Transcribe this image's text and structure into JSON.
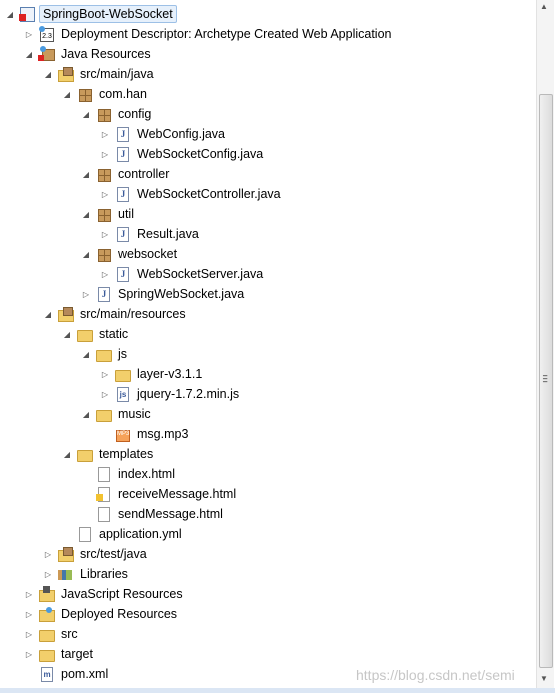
{
  "tree": [
    {
      "label": "SpringBoot-WebSocket",
      "level": 0,
      "state": "open",
      "icon": "project-icon",
      "selected": true
    },
    {
      "label": "Deployment Descriptor: Archetype Created Web Application",
      "level": 1,
      "state": "closed",
      "icon": "deployment-descriptor-icon"
    },
    {
      "label": "Java Resources",
      "level": 1,
      "state": "open",
      "icon": "java-resources-icon"
    },
    {
      "label": "src/main/java",
      "level": 2,
      "state": "open",
      "icon": "source-folder-icon"
    },
    {
      "label": "com.han",
      "level": 3,
      "state": "open",
      "icon": "package-icon"
    },
    {
      "label": "config",
      "level": 4,
      "state": "open",
      "icon": "package-icon"
    },
    {
      "label": "WebConfig.java",
      "level": 5,
      "state": "closed",
      "icon": "java-file-icon"
    },
    {
      "label": "WebSocketConfig.java",
      "level": 5,
      "state": "closed",
      "icon": "java-file-icon"
    },
    {
      "label": "controller",
      "level": 4,
      "state": "open",
      "icon": "package-icon"
    },
    {
      "label": "WebSocketController.java",
      "level": 5,
      "state": "closed",
      "icon": "java-file-icon"
    },
    {
      "label": "util",
      "level": 4,
      "state": "open",
      "icon": "package-icon"
    },
    {
      "label": "Result.java",
      "level": 5,
      "state": "closed",
      "icon": "java-file-icon"
    },
    {
      "label": "websocket",
      "level": 4,
      "state": "open",
      "icon": "package-icon"
    },
    {
      "label": "WebSocketServer.java",
      "level": 5,
      "state": "closed",
      "icon": "java-file-icon"
    },
    {
      "label": "SpringWebSocket.java",
      "level": 4,
      "state": "closed",
      "icon": "java-file-icon"
    },
    {
      "label": "src/main/resources",
      "level": 2,
      "state": "open",
      "icon": "source-folder-icon"
    },
    {
      "label": "static",
      "level": 3,
      "state": "open",
      "icon": "folder-icon"
    },
    {
      "label": "js",
      "level": 4,
      "state": "open",
      "icon": "folder-icon"
    },
    {
      "label": "layer-v3.1.1",
      "level": 5,
      "state": "closed",
      "icon": "folder-icon"
    },
    {
      "label": "jquery-1.7.2.min.js",
      "level": 5,
      "state": "closed",
      "icon": "js-file-icon"
    },
    {
      "label": "music",
      "level": 4,
      "state": "open",
      "icon": "folder-icon"
    },
    {
      "label": "msg.mp3",
      "level": 5,
      "state": "leaf",
      "icon": "mp3-file-icon"
    },
    {
      "label": "templates",
      "level": 3,
      "state": "open",
      "icon": "folder-icon"
    },
    {
      "label": "index.html",
      "level": 4,
      "state": "leaf",
      "icon": "html-file-icon"
    },
    {
      "label": "receiveMessage.html",
      "level": 4,
      "state": "leaf",
      "icon": "html-warning-file-icon"
    },
    {
      "label": "sendMessage.html",
      "level": 4,
      "state": "leaf",
      "icon": "html-file-icon"
    },
    {
      "label": "application.yml",
      "level": 3,
      "state": "leaf",
      "icon": "file-icon"
    },
    {
      "label": "src/test/java",
      "level": 2,
      "state": "closed",
      "icon": "source-folder-icon"
    },
    {
      "label": "Libraries",
      "level": 2,
      "state": "closed",
      "icon": "libraries-icon"
    },
    {
      "label": "JavaScript Resources",
      "level": 1,
      "state": "closed",
      "icon": "javascript-resources-icon"
    },
    {
      "label": "Deployed Resources",
      "level": 1,
      "state": "closed",
      "icon": "deployed-resources-icon"
    },
    {
      "label": "src",
      "level": 1,
      "state": "closed",
      "icon": "folder-icon"
    },
    {
      "label": "target",
      "level": 1,
      "state": "closed",
      "icon": "folder-icon"
    },
    {
      "label": "pom.xml",
      "level": 1,
      "state": "leaf",
      "icon": "xml-file-icon"
    }
  ],
  "watermark": "https://blog.csdn.net/semi"
}
